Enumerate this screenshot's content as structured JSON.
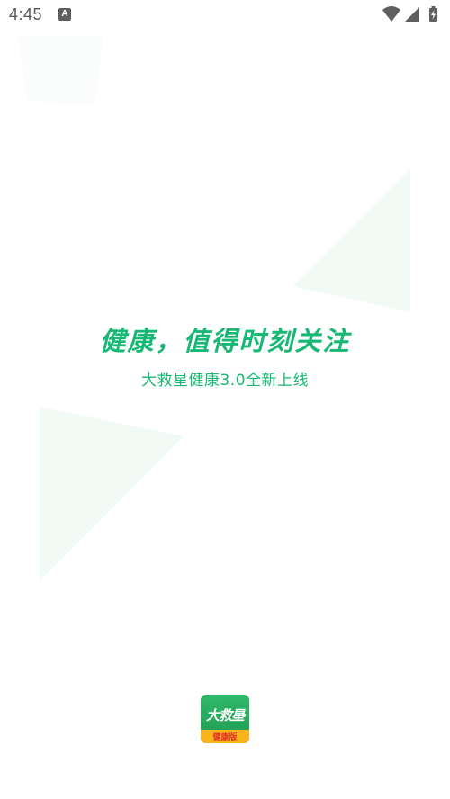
{
  "status_bar": {
    "time": "4:45",
    "notification_icon": "a-icon",
    "notification_glyph": "A",
    "wifi_icon": "wifi-icon",
    "signal_icon": "cell-signal-icon",
    "battery_icon": "battery-charging-icon"
  },
  "splash": {
    "headline": "健康，值得时刻关注",
    "subline": "大救星健康3.0全新上线",
    "accent_color": "#17b873"
  },
  "app_logo": {
    "name": "大救星",
    "edition": "健康版",
    "icon": "app-logo-icon"
  }
}
